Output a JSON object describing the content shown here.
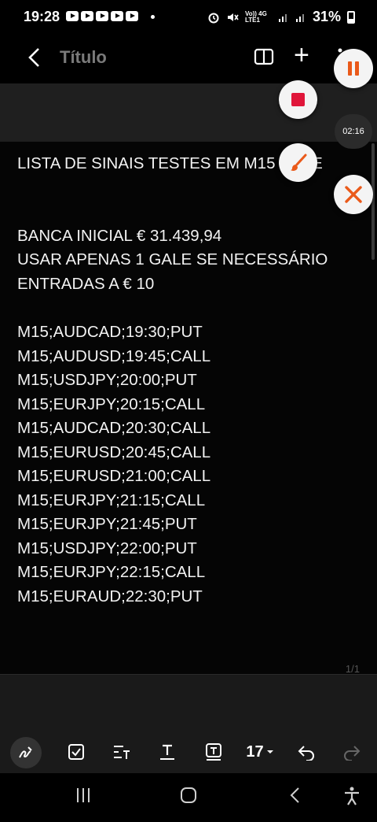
{
  "status_bar": {
    "time": "19:28",
    "network_label": "Vo)) 4G LTE1",
    "battery": "31%"
  },
  "app_bar": {
    "title": "Título"
  },
  "recorder": {
    "timer": "02:16",
    "accent_color": "#ea5a1a",
    "stop_color": "#e0163a"
  },
  "document": {
    "lines": [
      "LISTA DE SINAIS TESTES EM M15 ... ITE",
      "",
      "BANCA INICIAL € 31.439,94",
      "USAR APENAS 1 GALE SE NECESSÁRIO",
      "ENTRADAS A € 10",
      "",
      "M15;AUDCAD;19:30;PUT",
      "M15;AUDUSD;19:45;CALL",
      "M15;USDJPY;20:00;PUT",
      "M15;EURJPY;20:15;CALL",
      "M15;AUDCAD;20:30;CALL",
      "M15;EURUSD;20:45;CALL",
      "M15;EURUSD;21:00;CALL",
      "M15;EURJPY;21:15;CALL",
      "M15;EURJPY;21:45;PUT",
      "M15;USDJPY;22:00;PUT",
      "M15;EURJPY;22:15;CALL",
      "M15;EURAUD;22:30;PUT"
    ],
    "page_indicator": "1/1"
  },
  "toolbar": {
    "font_size": "17"
  },
  "icons": {
    "back": "back-arrow-icon",
    "book": "book-view-icon",
    "add": "plus-icon",
    "more": "more-vertical-icon",
    "pen": "pen-icon",
    "checkbox": "checkbox-icon",
    "text_style": "text-style-icon",
    "underline_text": "text-underline-icon",
    "text_box": "text-box-icon",
    "undo": "undo-icon",
    "redo": "redo-icon",
    "recents": "recents-icon",
    "home": "home-icon",
    "nav_back": "nav-back-icon",
    "accessibility": "accessibility-icon"
  }
}
